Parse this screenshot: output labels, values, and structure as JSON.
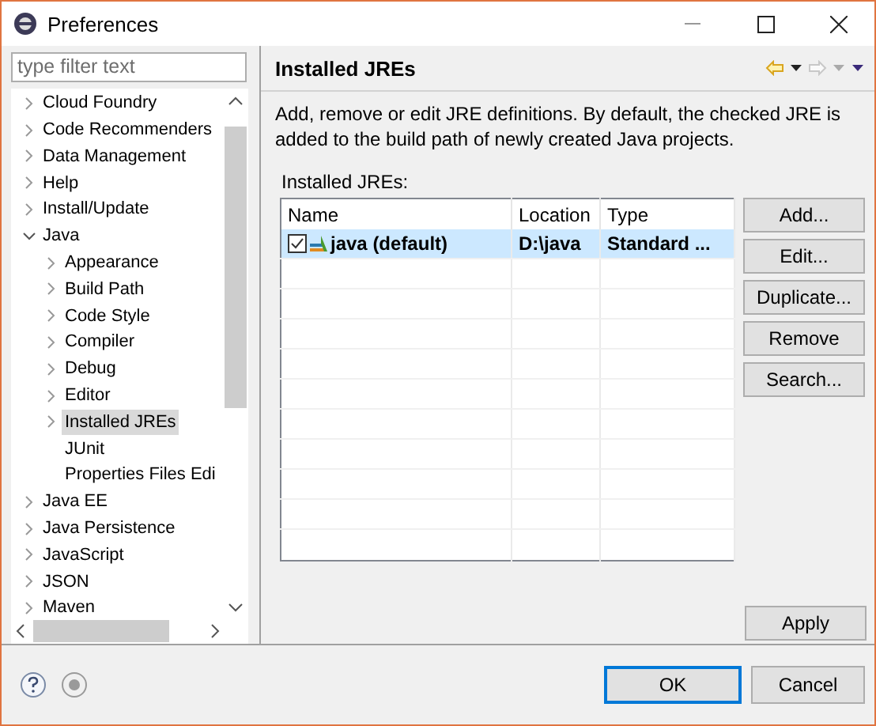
{
  "window": {
    "title": "Preferences"
  },
  "filter": {
    "placeholder": "type filter text"
  },
  "tree": [
    {
      "label": "Cloud Foundry",
      "expandable": true,
      "expanded": false,
      "selected": false
    },
    {
      "label": "Code Recommenders",
      "expandable": true,
      "expanded": false,
      "selected": false
    },
    {
      "label": "Data Management",
      "expandable": true,
      "expanded": false,
      "selected": false
    },
    {
      "label": "Help",
      "expandable": true,
      "expanded": false,
      "selected": false
    },
    {
      "label": "Install/Update",
      "expandable": true,
      "expanded": false,
      "selected": false
    },
    {
      "label": "Java",
      "expandable": true,
      "expanded": true,
      "selected": false,
      "children": [
        {
          "label": "Appearance",
          "expandable": true,
          "expanded": false,
          "selected": false
        },
        {
          "label": "Build Path",
          "expandable": true,
          "expanded": false,
          "selected": false
        },
        {
          "label": "Code Style",
          "expandable": true,
          "expanded": false,
          "selected": false
        },
        {
          "label": "Compiler",
          "expandable": true,
          "expanded": false,
          "selected": false
        },
        {
          "label": "Debug",
          "expandable": true,
          "expanded": false,
          "selected": false
        },
        {
          "label": "Editor",
          "expandable": true,
          "expanded": false,
          "selected": false
        },
        {
          "label": "Installed JREs",
          "expandable": true,
          "expanded": false,
          "selected": true
        },
        {
          "label": "JUnit",
          "expandable": false,
          "expanded": false,
          "selected": false
        },
        {
          "label": "Properties Files Edi",
          "expandable": false,
          "expanded": false,
          "selected": false
        }
      ]
    },
    {
      "label": "Java EE",
      "expandable": true,
      "expanded": false,
      "selected": false
    },
    {
      "label": "Java Persistence",
      "expandable": true,
      "expanded": false,
      "selected": false
    },
    {
      "label": "JavaScript",
      "expandable": true,
      "expanded": false,
      "selected": false
    },
    {
      "label": "JSON",
      "expandable": true,
      "expanded": false,
      "selected": false
    },
    {
      "label": "Maven",
      "expandable": true,
      "expanded": false,
      "selected": false
    }
  ],
  "page": {
    "title": "Installed JREs",
    "description": "Add, remove or edit JRE definitions. By default, the checked JRE is added to the build path of newly created Java projects.",
    "table_label": "Installed JREs:",
    "table": {
      "columns": [
        "Name",
        "Location",
        "Type"
      ],
      "rows": [
        {
          "cells": [
            "java (default)",
            "D:\\java",
            "Standard ..."
          ],
          "checked": true,
          "selected": true
        }
      ]
    },
    "buttons": [
      "Add...",
      "Edit...",
      "Duplicate...",
      "Remove",
      "Search..."
    ],
    "apply_button": "Apply"
  },
  "footer": {
    "buttons": [
      {
        "label": "OK",
        "default": true
      },
      {
        "label": "Cancel",
        "default": false
      }
    ]
  }
}
